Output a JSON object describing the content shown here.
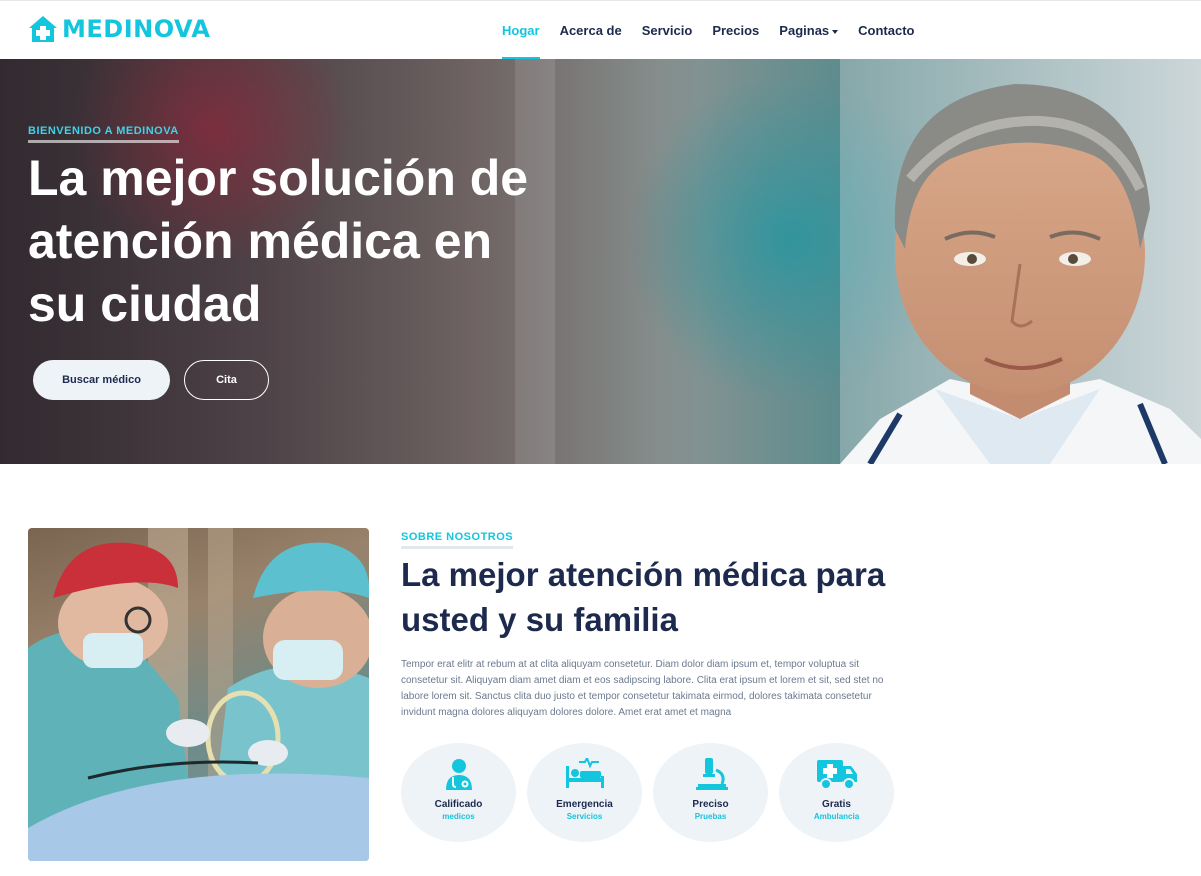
{
  "brand": {
    "name": "MEDINOVA",
    "icon": "house-medical-icon"
  },
  "nav": {
    "items": [
      {
        "label": "Hogar",
        "active": true
      },
      {
        "label": "Acerca de"
      },
      {
        "label": "Servicio"
      },
      {
        "label": "Precios"
      },
      {
        "label": "Paginas",
        "dropdown": true
      },
      {
        "label": "Contacto"
      }
    ]
  },
  "hero": {
    "kicker": "BIENVENIDO A MEDINOVA",
    "title": "La mejor solución de atención médica en su ciudad",
    "primary_button": "Buscar médico",
    "secondary_button": "Cita"
  },
  "about": {
    "kicker": "SOBRE NOSOTROS",
    "title": "La mejor atención médica para usted y su familia",
    "text": "Tempor erat elitr at rebum at at clita aliquyam consetetur. Diam dolor diam ipsum et, tempor voluptua sit consetetur sit. Aliquyam diam amet diam et eos sadipscing labore. Clita erat ipsum et lorem et sit, sed stet no labore lorem sit. Sanctus clita duo justo et tempor consetetur takimata eirmod, dolores takimata consetetur invidunt magna dolores aliquyam dolores dolore. Amet erat amet et magna",
    "features": [
      {
        "icon": "doctor-icon",
        "title": "Calificado",
        "subtitle": "medicos"
      },
      {
        "icon": "hospital-bed-icon",
        "title": "Emergencia",
        "subtitle": "Servicios"
      },
      {
        "icon": "microscope-icon",
        "title": "Preciso",
        "subtitle": "Pruebas"
      },
      {
        "icon": "ambulance-icon",
        "title": "Gratis",
        "subtitle": "Ambulancia"
      }
    ]
  },
  "colors": {
    "accent": "#13c5dd",
    "dark": "#1d2a4d",
    "light": "#eef3f8"
  }
}
